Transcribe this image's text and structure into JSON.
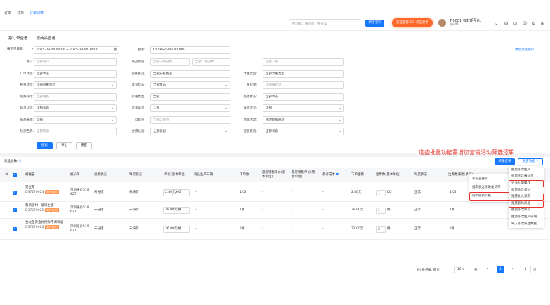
{
  "breadcrumb": [
    "订单",
    "订单",
    "订单列表"
  ],
  "header": {
    "search_placeholder": "搜功能、搜页面、搜答案",
    "blue_button": "新手引导",
    "orange_button": "签证查看 1/3  点击更新",
    "user_name": "TI0001 有效期至01",
    "user_sub": "zjxi01"
  },
  "tabs": [
    "按订单查看",
    "按商品查看"
  ],
  "filters": {
    "date_type": "按下单日期",
    "date_range": "2025-08-04 00:00 ~ 2025-08-04 24:00",
    "search_label": "搜索:",
    "search_value": "QXSPS25080400002",
    "more_link": "收起高级搜索",
    "rows": [
      [
        {
          "label": "客户:",
          "value": "全部客户",
          "select": false,
          "placeholder": true
        },
        {
          "label": "商品所属:",
          "value": "全部一级分类",
          "select": false,
          "placeholder": true,
          "extra": "全部二级分类"
        },
        {
          "label": "",
          "value": "全部三级",
          "select": false,
          "placeholder": true
        }
      ],
      [
        {
          "label": "订单状态:",
          "value": "全部状态",
          "select": true
        },
        {
          "label": "分拣备注:",
          "value": "全部分拣备注",
          "select": true
        },
        {
          "label": "计重类型:",
          "value": "全部计重类型",
          "select": true
        }
      ],
      [
        {
          "label": "称重状态:",
          "value": "全部称重状态",
          "select": true
        },
        {
          "label": "发货状态:",
          "value": "全部状态",
          "select": true
        },
        {
          "label": "报价单:",
          "value": "全部报价单",
          "select": false,
          "placeholder": true
        }
      ],
      [
        {
          "label": "线路筛选:",
          "value": "全部线路",
          "select": false,
          "placeholder": true
        },
        {
          "label": "价格类型:",
          "value": "全部",
          "select": true
        },
        {
          "label": "签收状态:",
          "value": "全部状态",
          "select": true
        }
      ],
      [
        {
          "label": "缺货状态:",
          "value": "全部状态",
          "select": true
        },
        {
          "label": "订单类型:",
          "value": "全部",
          "select": true
        },
        {
          "label": "收货方式:",
          "value": "全部",
          "select": true
        }
      ],
      [
        {
          "label": "商品来源:",
          "value": "全部",
          "select": true
        },
        {
          "label": "自提点:",
          "value": "全部自提点",
          "select": false,
          "placeholder": true
        },
        {
          "label": "营销活动:",
          "value": "限时促销商品",
          "select": true
        }
      ],
      [
        {
          "label": "检测名称:",
          "value": "全部检测",
          "select": false,
          "placeholder": true
        },
        {
          "label": "分拣状态:",
          "value": "全部状态",
          "select": true
        },
        {
          "label": "签收状态:",
          "value": "全部状态",
          "select": true
        }
      ]
    ],
    "buttons": {
      "search": "搜索",
      "export": "导出",
      "reset": "重置"
    }
  },
  "list": {
    "count_label": "商品总数:",
    "count_value": "3",
    "annotation": "这些批量功能需增加营销活动筛选逻辑",
    "new_batch_button": "新建订单",
    "more_button": "更多功能"
  },
  "table": {
    "columns": [
      "规格名",
      "报价单",
      "分拣状态",
      "缺货状态",
      "单价(基本单位)",
      "商品生产日期",
      "下单数",
      "最近销售单价(基本单位)",
      "最近销售单价(销售单位)",
      "参考成本",
      "下单金额",
      "出库数(基本单位)",
      "缺货状态",
      "出库数(销售单位)"
    ],
    "rows": [
      {
        "name": "黄豆芽",
        "code": "D37270024",
        "tag": "限时促销",
        "quote": "深圳报价519 627",
        "sort": "未分拣",
        "stock": "未缺货",
        "price": "2.40元/KG",
        "prod_date": "-",
        "qty": "1KG",
        "last1": "-",
        "last2": "-",
        "cost": "-",
        "amount": "2.40元",
        "out_base": "1",
        "out_unit": "KG",
        "status": "正常",
        "out_sale": "1KG"
      },
      {
        "name": "鲁南农村一级鸡生蛋",
        "code": "D37270025",
        "tag": "限时促销",
        "quote": "深圳报价519 627",
        "sort": "未分拣",
        "stock": "未缺货",
        "price": "38.90元/桶",
        "prod_date": "-",
        "qty": "1桶",
        "last1": "-",
        "last2": "-",
        "cost": "-",
        "amount": "38.90元",
        "out_base": "1",
        "out_unit": "桶",
        "status": "正常",
        "out_sale": "1桶"
      },
      {
        "name": "金龙鱼黄金比例食用调和油",
        "code": "D37270026",
        "tag": "限时促销",
        "quote": "深圳报价519 627",
        "sort": "未分拣",
        "stock": "未缺货",
        "price": "36.00元/桶",
        "prod_date": "-",
        "qty": "2桶",
        "last1": "-",
        "last2": "-",
        "cost": "-",
        "amount": "72.00元",
        "out_base": "2",
        "out_unit": "桶",
        "status": "正常",
        "out_sale": "2桶"
      }
    ]
  },
  "dropdown_left": [
    "不设置备货",
    "批次状态修改备货单",
    "同步最新价格"
  ],
  "dropdown_right": [
    "批量修改生产",
    "批量修改报价单",
    "更多批量操作",
    "批量修改单价",
    "批量加入采购",
    "批量删除商品",
    "批量修改单价",
    "批量修改生产日期",
    "导入修改商品数据"
  ],
  "pagination": {
    "summary": "共3条记录, 每页",
    "page_size": "10",
    "unit": "条",
    "current": "1",
    "goto": "1",
    "page_label": "页"
  }
}
